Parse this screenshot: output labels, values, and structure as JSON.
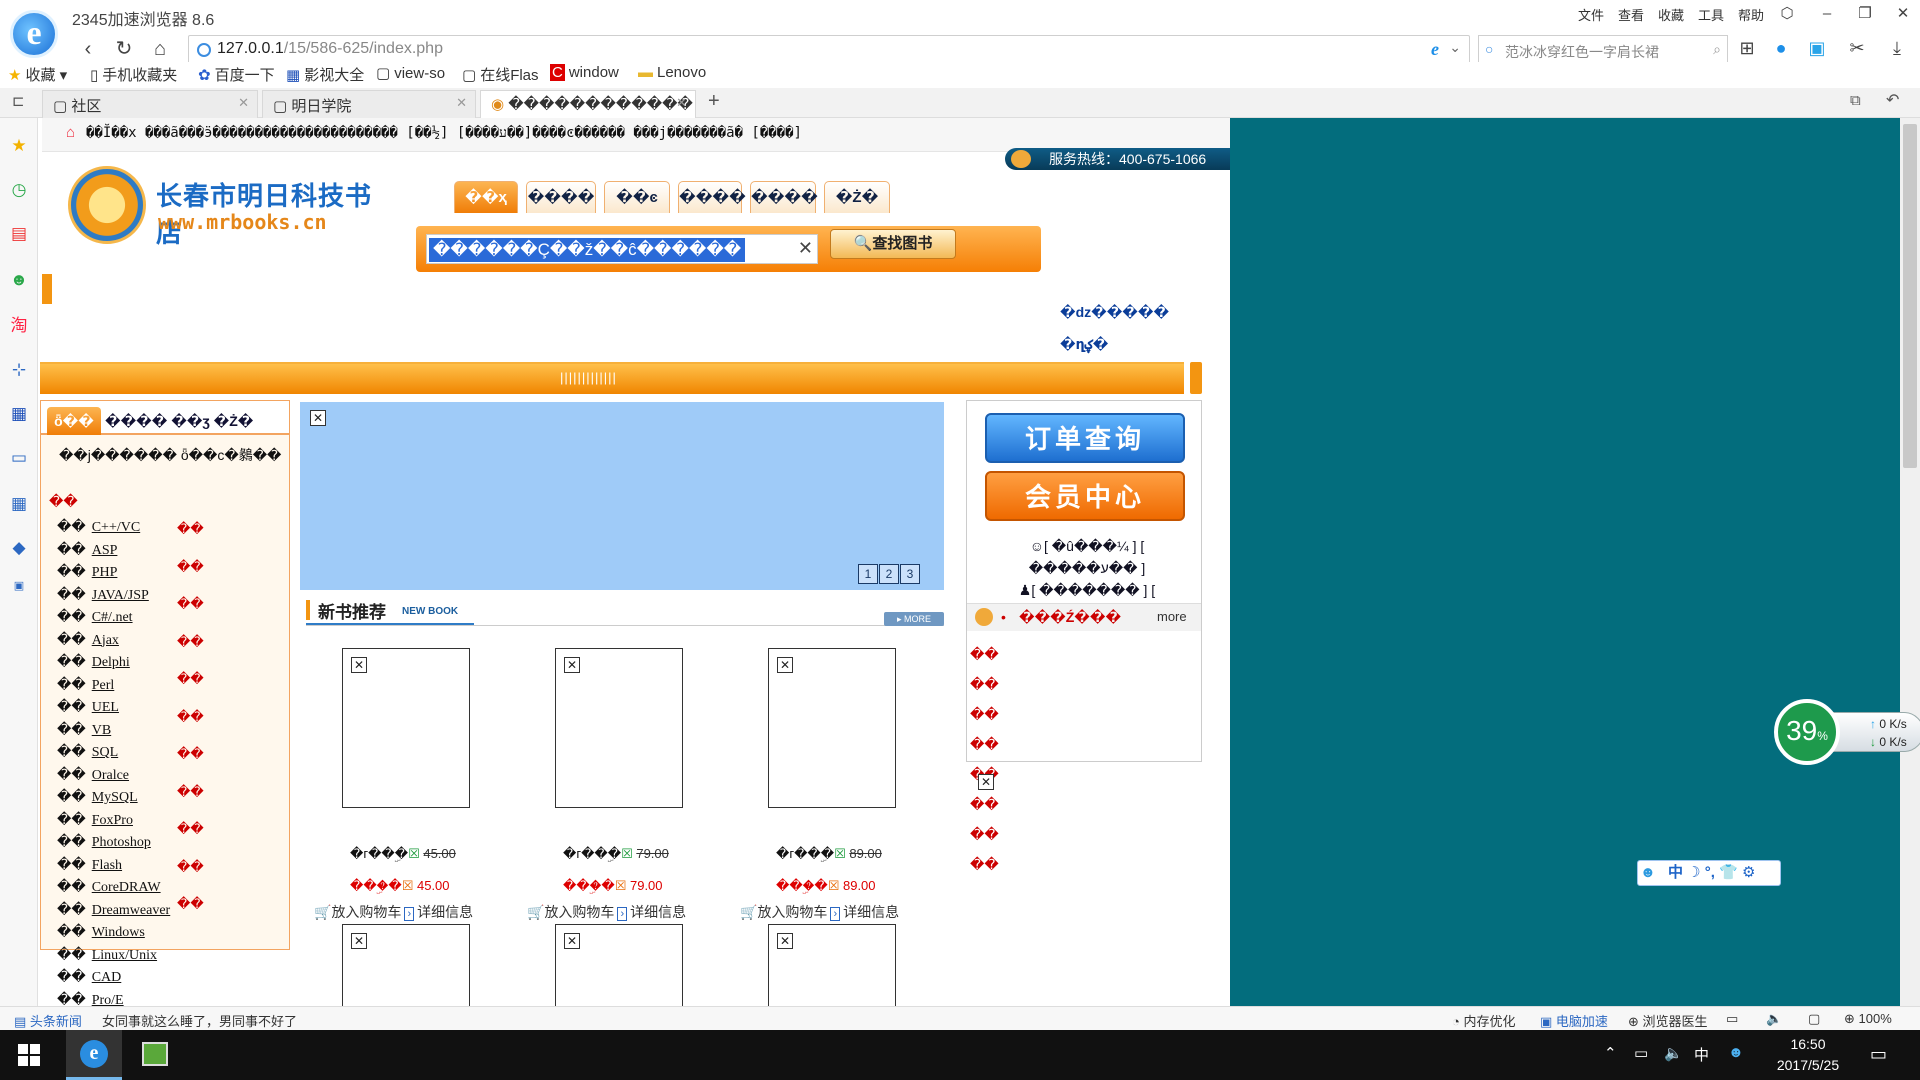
{
  "window": {
    "title": "2345加速浏览器 8.6",
    "menu": [
      "文件",
      "查看",
      "收藏",
      "工具",
      "帮助"
    ]
  },
  "address_bar": {
    "url_host": "127.0.0.1",
    "url_path": "/15/586-625/index.php",
    "search_placeholder": "范冰冰穿红色一字肩长裙"
  },
  "bookmarks": [
    {
      "label": "收藏",
      "icon": "star-icon"
    },
    {
      "label": "手机收藏夹",
      "icon": "phone-icon"
    },
    {
      "label": "百度一下",
      "icon": "paw-icon"
    },
    {
      "label": "影视大全",
      "icon": "film-icon"
    },
    {
      "label": "view-so",
      "icon": "page-icon"
    },
    {
      "label": "在线Flas",
      "icon": "page-icon"
    },
    {
      "label": "window",
      "icon": "c-icon"
    },
    {
      "label": "Lenovo",
      "icon": "folder-icon"
    }
  ],
  "tabs": [
    {
      "label": "社区",
      "active": false
    },
    {
      "label": "明日学院",
      "active": false
    },
    {
      "label": "������������ - ����",
      "active": true
    }
  ],
  "web": {
    "top_strip": "��Ĭ��x     ���ã���ӭ����������������������   [��½] [����ע��]����ͼ������   ���j�������ã� [����]",
    "hotline": "服务热线：400-675-1066",
    "logo_cn": "长春市明日科技书店",
    "logo_en": "www.mrbooks.cn",
    "nav_tabs": [
      "��ҳ",
      "����",
      "��ͼ",
      "����",
      "����",
      "�Ż�"
    ],
    "search_value": "������Ç��ž��ĉ������",
    "search_button": "查找图书",
    "right_links": [
      "�ǳ�����",
      "�ղؼ�"
    ],
    "band_text": "|||||||||||||",
    "category_tabs_on": "ȫ��",
    "category_tabs_rest": "���� ��ӡ  �Ż�",
    "category_sub": "��j������ ȫ��c�鶨��",
    "category_head": "��",
    "categories": [
      "C++/VC",
      "ASP",
      "PHP",
      "JAVA/JSP",
      "C#/.net",
      "Ajax",
      "Delphi",
      "Perl",
      "UEL",
      "VB",
      "SQL",
      "Oralce",
      "MySQL",
      "FoxPro",
      "Photoshop",
      "Flash",
      "CoreDRAW",
      "Dreamweaver",
      "Windows",
      "Linux/Unix",
      "CAD",
      "Pro/E"
    ],
    "category_prefix": "��",
    "category_right_marks": [
      "��",
      "��",
      "��",
      "��",
      "��",
      "��",
      "��",
      "��",
      "��",
      "��",
      "��"
    ],
    "banner_pages": [
      "1",
      "2",
      "3"
    ],
    "new_books_title": "新书推荐",
    "new_books_en": "NEW BOOK",
    "new_books_more": "MORE",
    "books": [
      {
        "old_label": "�г��ۣ�",
        "old_price": "45.00",
        "new_label": "���ۣ�",
        "new_price": "45.00"
      },
      {
        "old_label": "�г��ۣ�",
        "old_price": "79.00",
        "new_label": "���ۣ�",
        "new_price": "79.00"
      },
      {
        "old_label": "�г��ۣ�",
        "old_price": "89.00",
        "new_label": "���ۣ�",
        "new_price": "89.00"
      }
    ],
    "add_cart": "放入购物车",
    "detail": "详细信息",
    "order_query": "订单查询",
    "member_center": "会员中心",
    "right_panel_links": [
      "[ �û���¼ ] [ ",
      "�����ע�� ]",
      "[ ������� ] [ "
    ],
    "notice_title": "���Ź���",
    "notice_more": "more",
    "notice_items": [
      "��",
      "��",
      "��",
      "��",
      "��",
      "��",
      "��",
      "��"
    ]
  },
  "widgets": {
    "net_percent": "39",
    "net_percent_unit": "%",
    "up_speed": "0 K/s",
    "down_speed": "0 K/s",
    "ime": "中 ☽ °, 👕 ⚙"
  },
  "statusbar": {
    "news_label": "头条新闻",
    "news_text": "女同事就这么睡了，男同事不好了",
    "memory": "内存优化",
    "speed": "电脑加速",
    "doctor": "浏览器医生",
    "zoom": "100%"
  },
  "taskbar": {
    "time": "16:50",
    "date": "2017/5/25",
    "ime": "中"
  }
}
